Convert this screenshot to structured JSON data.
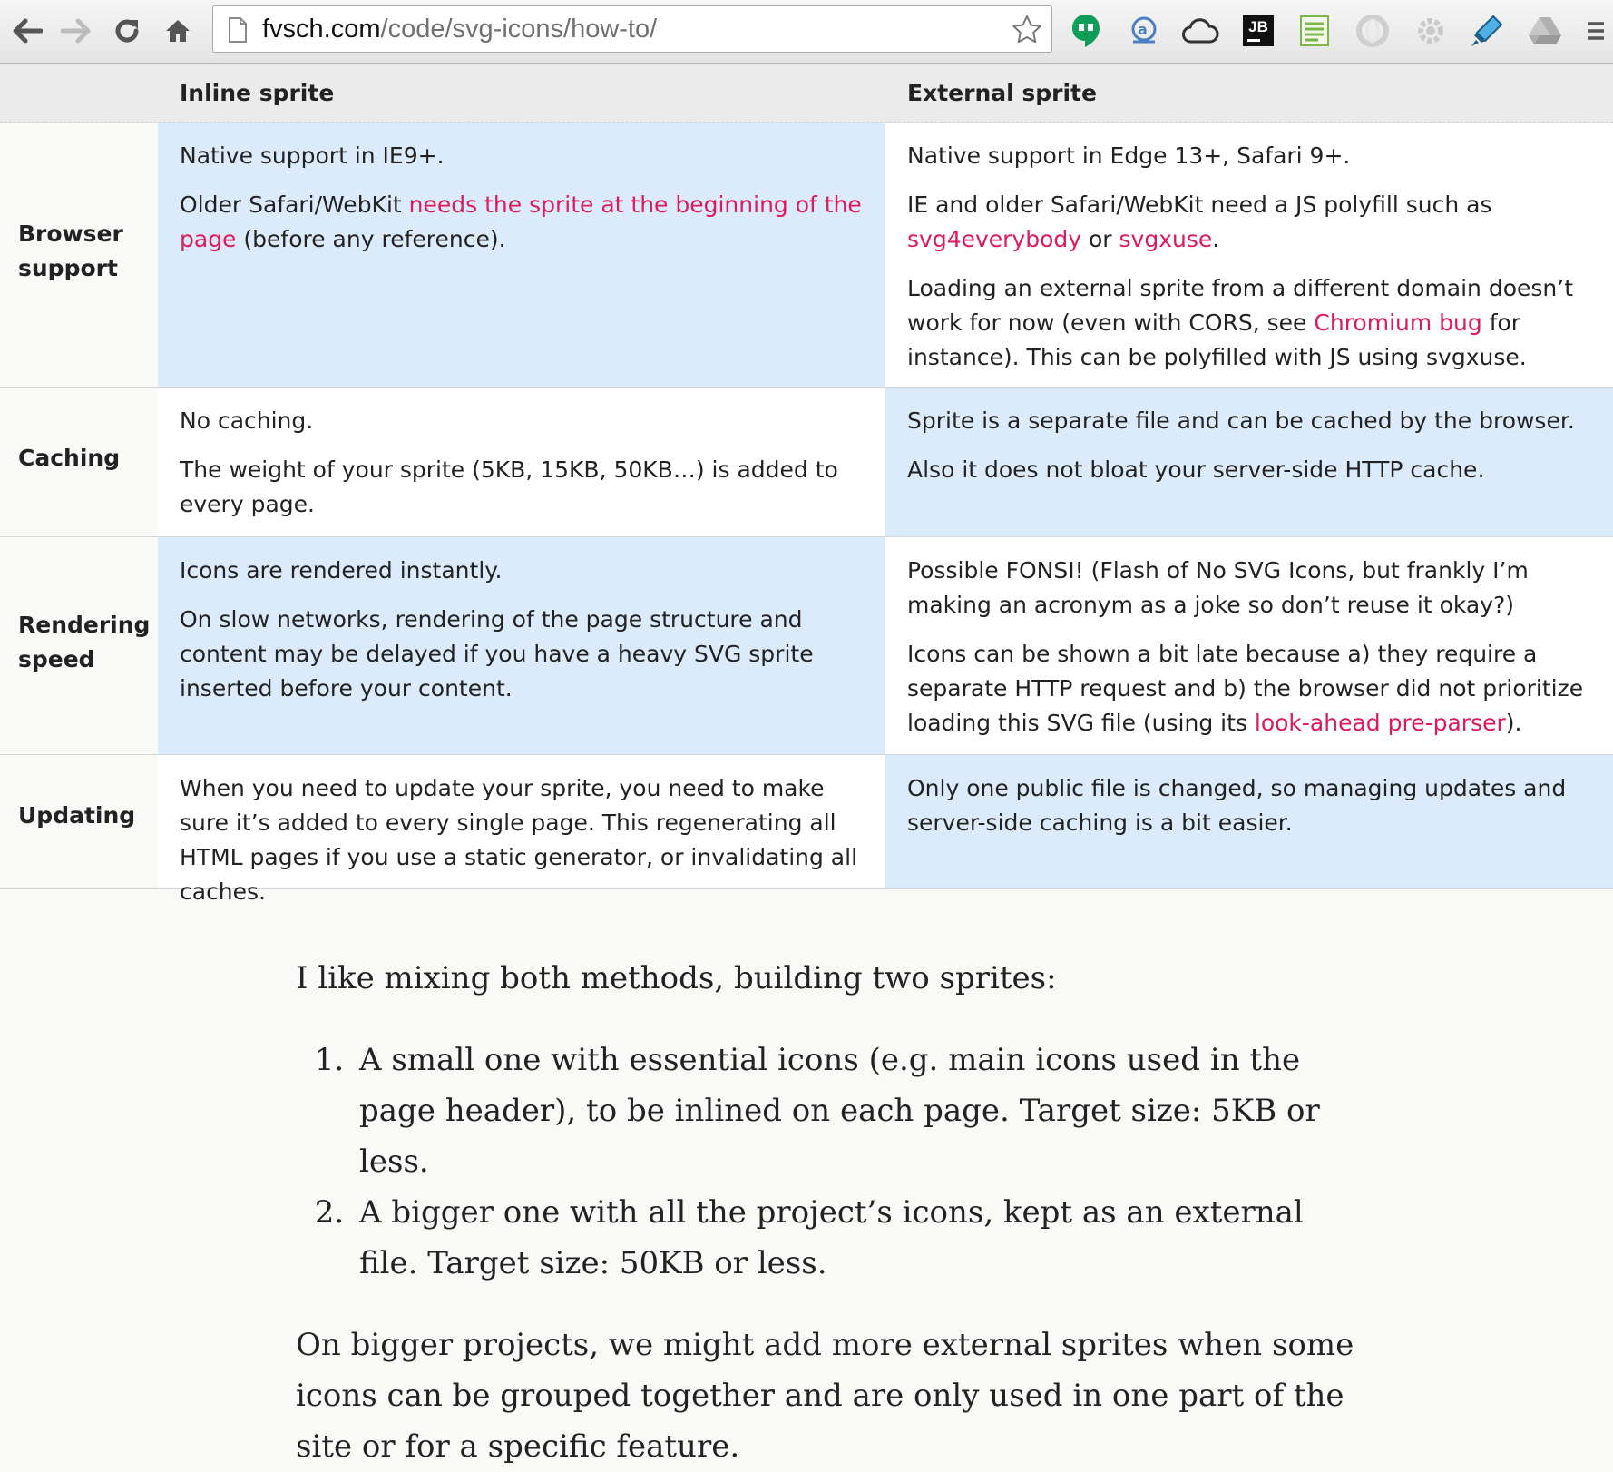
{
  "browser": {
    "url_host": "fvsch.com",
    "url_path": "/code/svg-icons/how-to/",
    "extensions": [
      "hangouts-icon",
      "translate-icon",
      "cloud-icon",
      "jetbrains-icon",
      "sheet-icon",
      "opera-icon",
      "settings-icon",
      "highlighter-icon",
      "drive-icon"
    ],
    "jetbrains_label": "JB"
  },
  "table": {
    "headers": [
      "Inline sprite",
      "External sprite"
    ],
    "rows": [
      {
        "label_line1": "Browser",
        "label_line2": "support",
        "inline": {
          "p1": "Native support in IE9+.",
          "p2_pre": "Older Safari/WebKit ",
          "p2_link": "needs the sprite at the beginning of the page",
          "p2_post": " (before any reference)."
        },
        "external": {
          "p1": "Native support in Edge 13+, Safari 9+.",
          "p2_pre": "IE and older Safari/WebKit need a JS polyfill such as ",
          "p2_link1": "svg4everybody",
          "p2_mid": " or ",
          "p2_link2": "svgxuse",
          "p2_post": ".",
          "p3_pre": "Loading an external sprite from a different domain doesn’t work for now (even with CORS, see ",
          "p3_link": "Chromium bug",
          "p3_post": " for instance). This can be polyfilled with JS using svgxuse."
        }
      },
      {
        "label": "Caching",
        "inline": {
          "p1": "No caching.",
          "p2": "The weight of your sprite (5KB, 15KB, 50KB…) is added to every page."
        },
        "external": {
          "p1": "Sprite is a separate file and can be cached by the browser.",
          "p2": "Also it does not bloat your server-side HTTP cache."
        }
      },
      {
        "label_line1": "Rendering",
        "label_line2": "speed",
        "inline": {
          "p1": "Icons are rendered instantly.",
          "p2": "On slow networks, rendering of the page structure and content may be delayed if you have a heavy SVG sprite inserted before your content."
        },
        "external": {
          "p1": "Possible FONSI! (Flash of No SVG Icons, but frankly I’m making an acronym as a joke so don’t reuse it okay?)",
          "p2_pre": "Icons can be shown a bit late because a) they require a separate HTTP request and b) the browser did not prioritize loading this SVG file (using its ",
          "p2_link": "look-ahead pre-parser",
          "p2_post": ")."
        }
      },
      {
        "label": "Updating",
        "inline": {
          "p1": "When you need to update your sprite, you need to make sure it’s added to every single page. This regenerating all HTML pages if you use a static generator, or invalidating all caches."
        },
        "external": {
          "p1": "Only one public file is changed, so managing updates and server-side caching is a bit easier."
        }
      }
    ]
  },
  "article": {
    "intro": "I like mixing both methods, building two sprites:",
    "list": [
      "A small one with essential icons (e.g. main icons used in the page header), to be inlined on each page. Target size: 5KB or less.",
      "A bigger one with all the project’s icons, kept as an external file. Target size: 50KB or less."
    ],
    "closing": "On bigger projects, we might add more external sprites when some icons can be grouped together and are only used in one part of the site or for a specific feature."
  },
  "colors": {
    "link": "#e0195a",
    "cell_highlight": "#dcebfb",
    "header_bg": "#ebebeb"
  }
}
